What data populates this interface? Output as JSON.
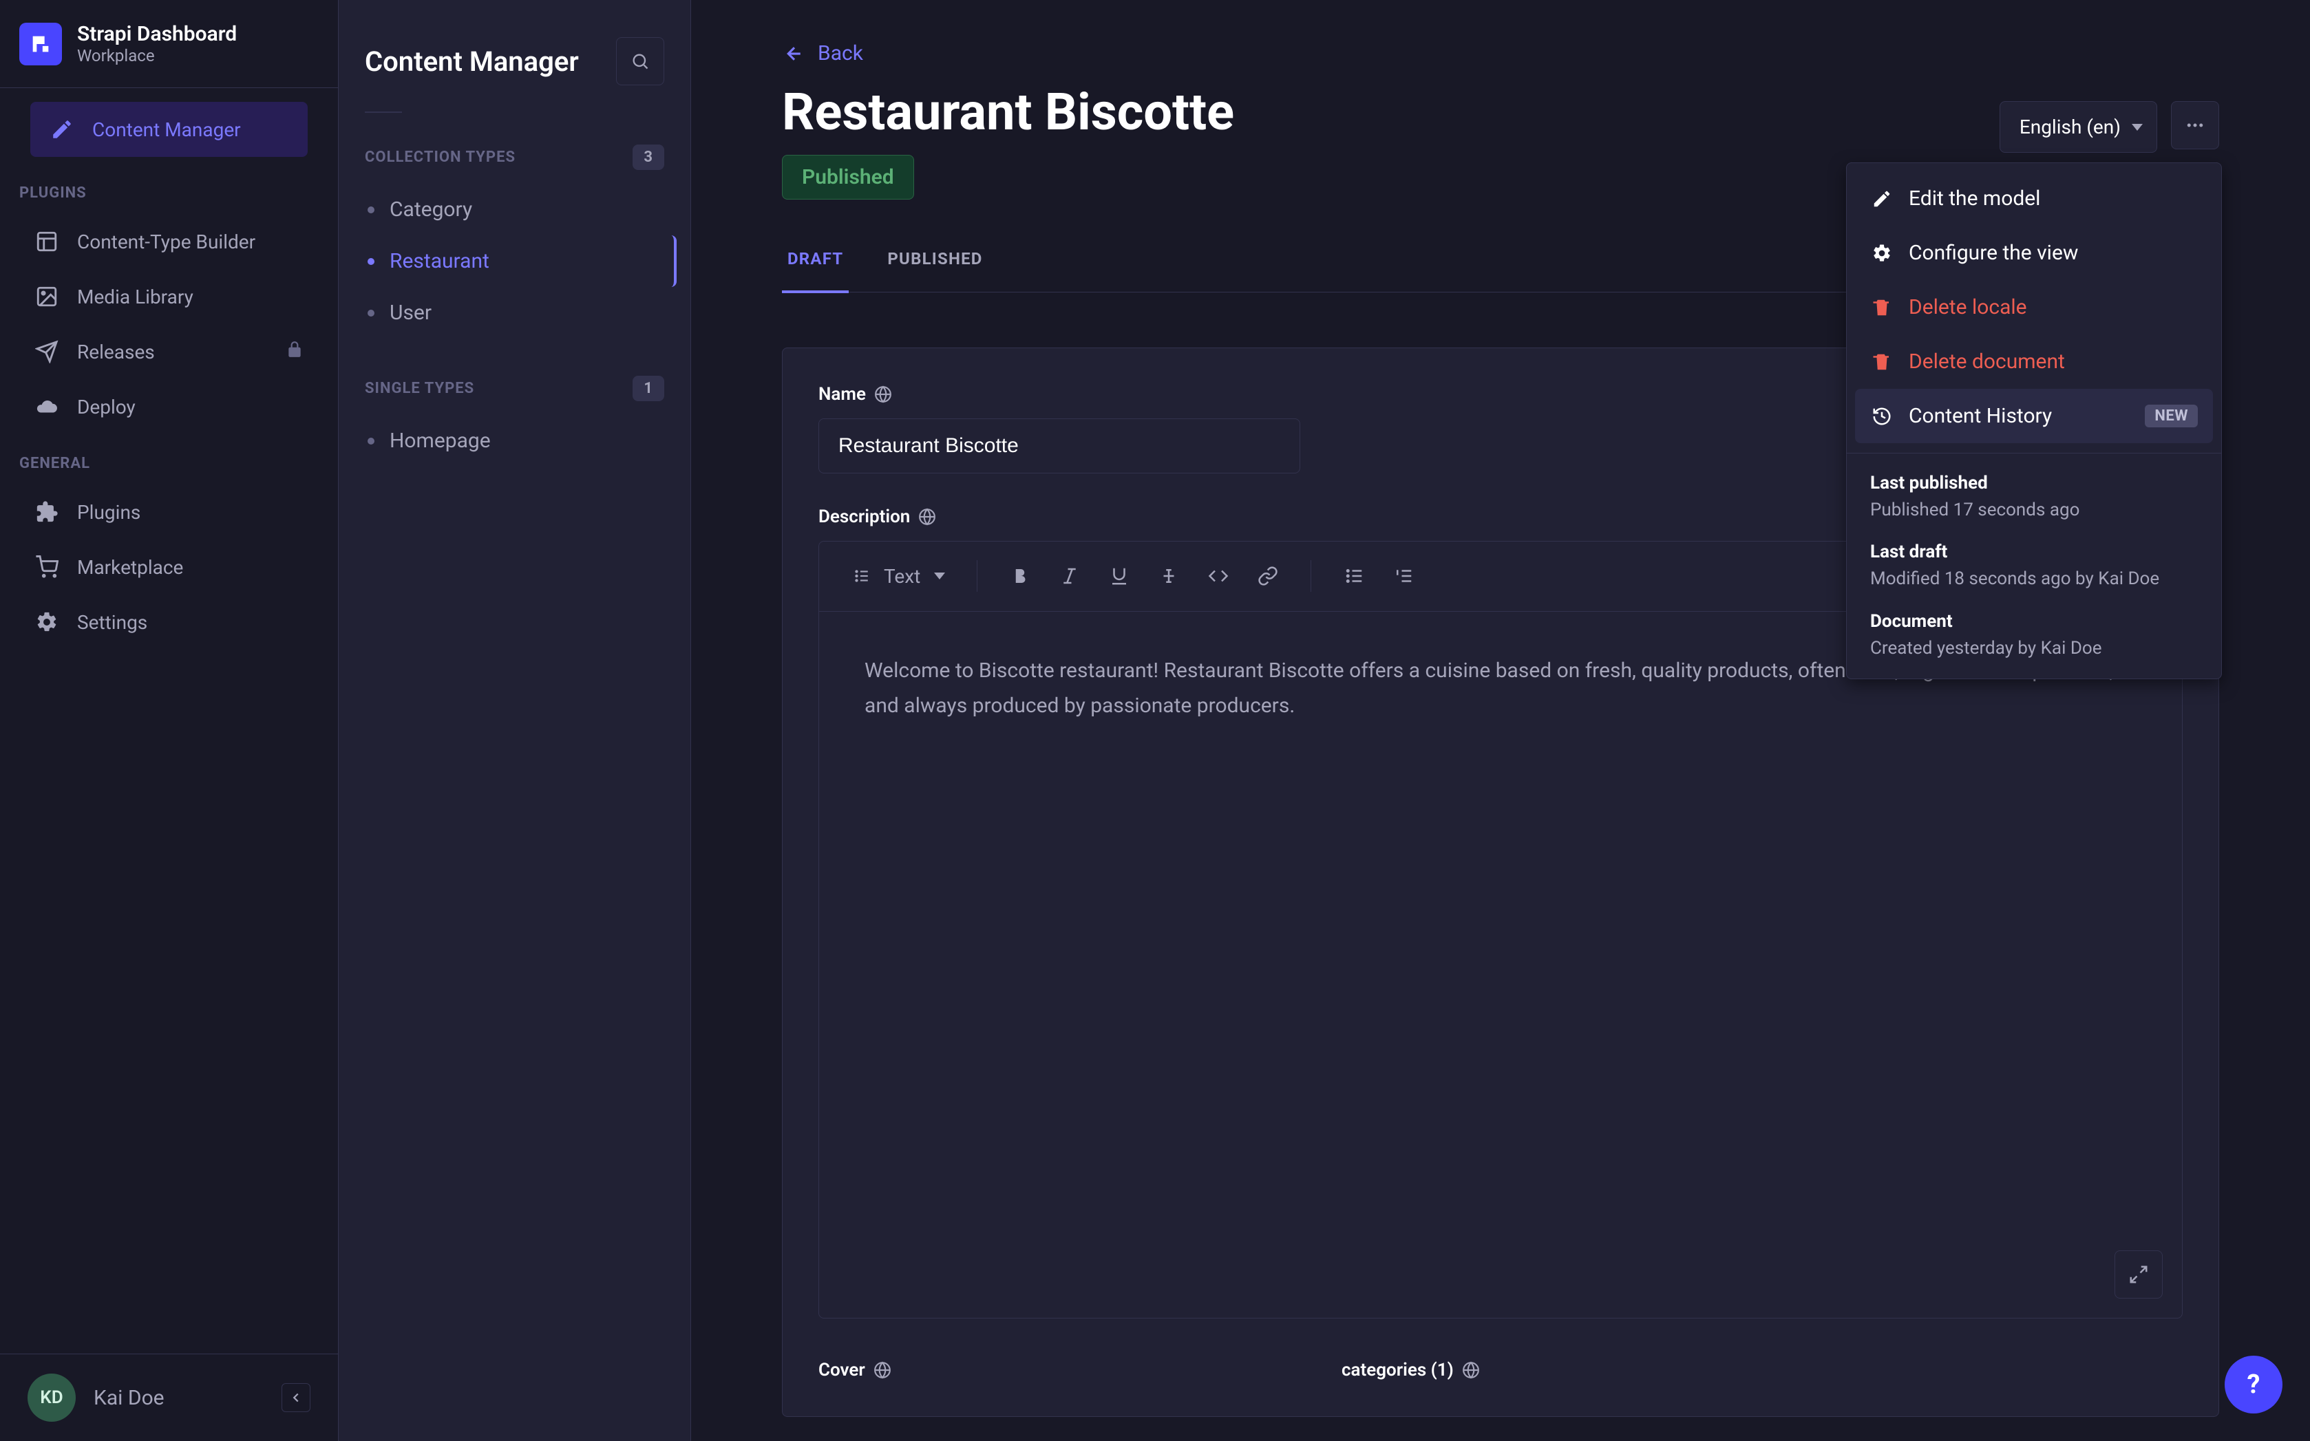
{
  "brand": {
    "title": "Strapi Dashboard",
    "subtitle": "Workplace"
  },
  "sidebar": {
    "content_manager": "Content Manager",
    "plugins_label": "PLUGINS",
    "items_plugins": [
      {
        "label": "Content-Type Builder"
      },
      {
        "label": "Media Library"
      },
      {
        "label": "Releases",
        "locked": true
      },
      {
        "label": "Deploy"
      }
    ],
    "general_label": "GENERAL",
    "items_general": [
      {
        "label": "Plugins"
      },
      {
        "label": "Marketplace"
      },
      {
        "label": "Settings"
      }
    ]
  },
  "user": {
    "initials": "KD",
    "name": "Kai Doe"
  },
  "second_nav": {
    "title": "Content Manager",
    "collection_label": "COLLECTION TYPES",
    "collection_count": "3",
    "collection_items": [
      "Category",
      "Restaurant",
      "User"
    ],
    "collection_active_index": 1,
    "single_label": "SINGLE TYPES",
    "single_count": "1",
    "single_items": [
      "Homepage"
    ]
  },
  "page": {
    "back": "Back",
    "title": "Restaurant Biscotte",
    "status": "Published",
    "locale": "English (en)",
    "tabs": {
      "draft": "DRAFT",
      "published": "PUBLISHED"
    },
    "fields": {
      "name_label": "Name",
      "name_value": "Restaurant Biscotte",
      "description_label": "Description",
      "description_value": "Welcome to Biscotte restaurant! Restaurant Biscotte offers a cuisine based on fresh, quality products, often local, organic when possible, and always produced by passionate producers.",
      "cover_label": "Cover",
      "categories_label": "categories (1)"
    },
    "rte": {
      "text_btn": "Text"
    }
  },
  "popover": {
    "edit_model": "Edit the model",
    "configure_view": "Configure the view",
    "delete_locale": "Delete locale",
    "delete_document": "Delete document",
    "content_history": "Content History",
    "new_badge": "NEW",
    "last_published_label": "Last published",
    "last_published_value": "Published 17 seconds ago",
    "last_draft_label": "Last draft",
    "last_draft_value": "Modified 18 seconds ago by Kai Doe",
    "document_label": "Document",
    "document_value": "Created yesterday by Kai Doe"
  },
  "help": "?"
}
